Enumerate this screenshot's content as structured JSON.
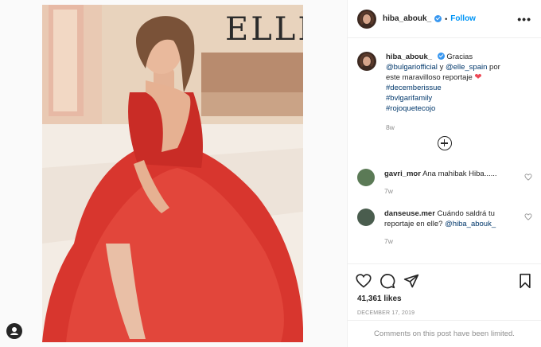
{
  "post": {
    "media": {
      "alt_brand": "ELLE"
    },
    "header": {
      "username": "hiba_abouk_",
      "separator": "•",
      "follow_label": "Follow",
      "more_label": "•••"
    },
    "caption": {
      "username": "hiba_abouk_",
      "text_before": "Gracias",
      "mention1": "@bulgariofficial",
      "text_mid": "y",
      "mention2": "@elle_spain",
      "text_after": "por este maravilloso reportaje",
      "heart": "❤",
      "hashtag1": "#decemberissue",
      "hashtag2": "#bvlgarifamily",
      "hashtag3": "#rojoquetecojo",
      "age": "8w"
    },
    "comments": [
      {
        "username": "gavri_mor",
        "text": "Ana mahibak Hiba......",
        "age": "7w"
      },
      {
        "username": "danseuse.mer",
        "text": "Cuándo saldrá tu reportaje en elle?",
        "mention": "@hiba_abouk_",
        "age": "7w"
      }
    ],
    "likes": "41,361 likes",
    "date": "DECEMBER 17, 2019",
    "comments_limited": "Comments on this post have been limited."
  }
}
